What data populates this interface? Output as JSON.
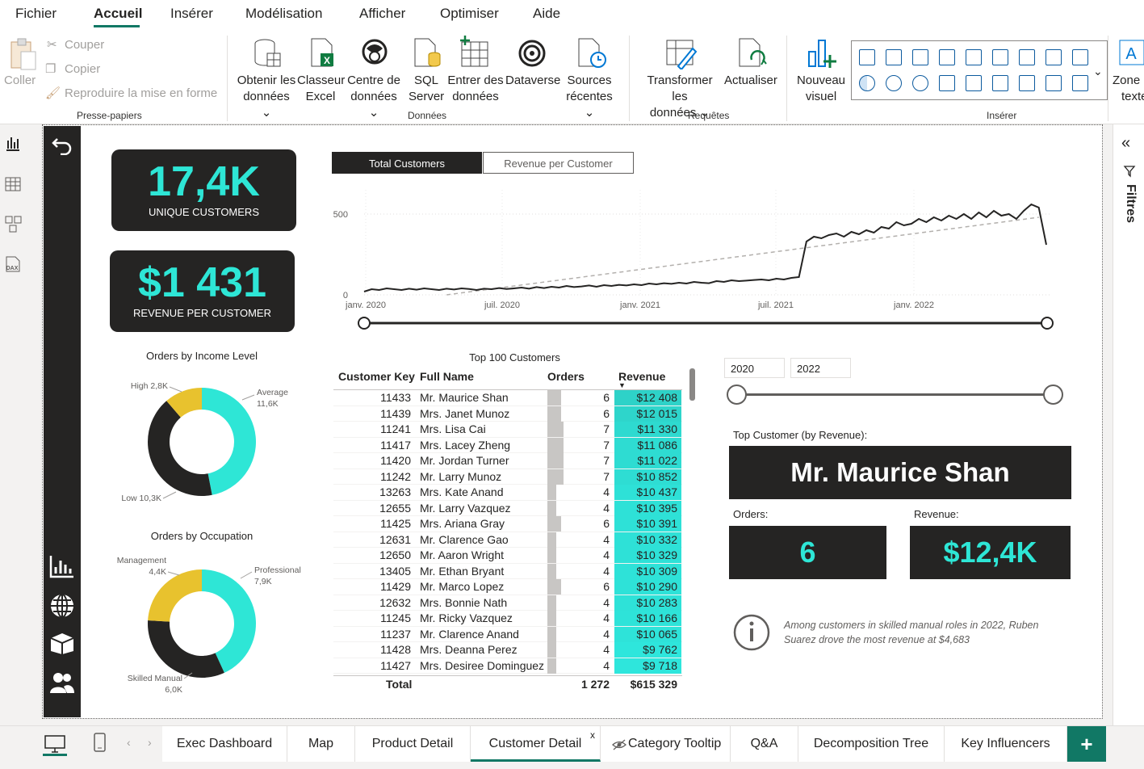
{
  "menu": {
    "items": [
      "Fichier",
      "Accueil",
      "Insérer",
      "Modélisation",
      "Afficher",
      "Optimiser",
      "Aide"
    ]
  },
  "ribbon": {
    "clipboard": {
      "paste": "Coller",
      "cut": "Couper",
      "copy": "Copier",
      "format_painter": "Reproduire la mise en forme",
      "group": "Presse-papiers"
    },
    "data": {
      "get_data": [
        "Obtenir les",
        "données"
      ],
      "excel": [
        "Classeur",
        "Excel"
      ],
      "datahub": [
        "Centre de",
        "données"
      ],
      "sql": [
        "SQL",
        "Server"
      ],
      "enter": [
        "Entrer des",
        "données"
      ],
      "dataverse": "Dataverse",
      "recent": [
        "Sources",
        "récentes"
      ],
      "group": "Données"
    },
    "queries": {
      "transform": [
        "Transformer les",
        "données"
      ],
      "refresh": "Actualiser",
      "group": "Requêtes"
    },
    "insert": {
      "new_visual": [
        "Nouveau",
        "visuel"
      ],
      "textbox": [
        "Zone",
        "texte"
      ],
      "group": "Insérer"
    }
  },
  "kpis": {
    "unique_customers_value": "17,4K",
    "unique_customers_label": "UNIQUE CUSTOMERS",
    "revenue_per_customer_value": "$1 431",
    "revenue_per_customer_label": "REVENUE PER CUSTOMER"
  },
  "line_tabs": {
    "active": "Total Customers",
    "inactive": "Revenue per Customer"
  },
  "chart_data": [
    {
      "type": "line",
      "title": "",
      "y_ticks": [
        "500",
        "0"
      ],
      "x_ticks": [
        "janv. 2020",
        "juil. 2020",
        "janv. 2021",
        "juil. 2021",
        "janv. 2022"
      ],
      "ylim": [
        0,
        600
      ],
      "series": [
        {
          "values": [
            20,
            35,
            30,
            40,
            35,
            30,
            38,
            32,
            40,
            35,
            30,
            38,
            33,
            40,
            36,
            30,
            38,
            35,
            42,
            36,
            40,
            45,
            38,
            48,
            42,
            50,
            45,
            55,
            48,
            52,
            58,
            50,
            60,
            55,
            62,
            58,
            65,
            60,
            70,
            65,
            72,
            68,
            75,
            70,
            80,
            75,
            72,
            85,
            80,
            90,
            85,
            88,
            92,
            95,
            90,
            100,
            95,
            105,
            110,
            330,
            360,
            350,
            370,
            380,
            360,
            390,
            375,
            400,
            385,
            420,
            410,
            450,
            430,
            440,
            470,
            450,
            480,
            460,
            490,
            470,
            500,
            470,
            510,
            480,
            520,
            490,
            500,
            470,
            520,
            560,
            540,
            310
          ]
        },
        {
          "values": [
            0,
            480
          ],
          "style": "dashed-trend"
        }
      ]
    },
    {
      "type": "pie",
      "title": "Orders by Income Level",
      "labels": [
        "Average",
        "Low",
        "High"
      ],
      "values": [
        11.6,
        10.3,
        2.8
      ],
      "display": [
        "11,6K",
        "10,3K",
        "2,8K"
      ],
      "colors": [
        "#2ee6d6",
        "#252423",
        "#e8c22e"
      ]
    },
    {
      "type": "pie",
      "title": "Orders by Occupation",
      "labels": [
        "Professional",
        "Skilled Manual",
        "Management"
      ],
      "values": [
        7.9,
        6.0,
        4.4
      ],
      "display": [
        "7,9K",
        "6,0K",
        "4,4K"
      ],
      "colors": [
        "#2ee6d6",
        "#252423",
        "#e8c22e"
      ]
    },
    {
      "type": "table",
      "title": "Top 100 Customers",
      "columns": [
        "Customer Key",
        "Full Name",
        "Orders",
        "Revenue"
      ],
      "rows": [
        [
          "11433",
          "Mr. Maurice Shan",
          "6",
          "$12 408"
        ],
        [
          "11439",
          "Mrs. Janet Munoz",
          "6",
          "$12 015"
        ],
        [
          "11241",
          "Mrs. Lisa Cai",
          "7",
          "$11 330"
        ],
        [
          "11417",
          "Mrs. Lacey Zheng",
          "7",
          "$11 086"
        ],
        [
          "11420",
          "Mr. Jordan Turner",
          "7",
          "$11 022"
        ],
        [
          "11242",
          "Mr. Larry Munoz",
          "7",
          "$10 852"
        ],
        [
          "13263",
          "Mrs. Kate Anand",
          "4",
          "$10 437"
        ],
        [
          "12655",
          "Mr. Larry Vazquez",
          "4",
          "$10 395"
        ],
        [
          "11425",
          "Mrs. Ariana Gray",
          "6",
          "$10 391"
        ],
        [
          "12631",
          "Mr. Clarence Gao",
          "4",
          "$10 332"
        ],
        [
          "12650",
          "Mr. Aaron Wright",
          "4",
          "$10 329"
        ],
        [
          "13405",
          "Mr. Ethan Bryant",
          "4",
          "$10 309"
        ],
        [
          "11429",
          "Mr. Marco Lopez",
          "6",
          "$10 290"
        ],
        [
          "12632",
          "Mrs. Bonnie Nath",
          "4",
          "$10 283"
        ],
        [
          "11245",
          "Mr. Ricky Vazquez",
          "4",
          "$10 166"
        ],
        [
          "11237",
          "Mr. Clarence Anand",
          "4",
          "$10 065"
        ],
        [
          "11428",
          "Mrs. Deanna Perez",
          "4",
          "$9 762"
        ],
        [
          "11427",
          "Mrs. Desiree Dominguez",
          "4",
          "$9 718"
        ]
      ],
      "total": {
        "label": "Total",
        "orders": "1 272",
        "revenue": "$615 329"
      }
    }
  ],
  "slicer": {
    "from": "2020",
    "to": "2022"
  },
  "top_customer": {
    "label": "Top Customer (by Revenue):",
    "name": "Mr. Maurice Shan",
    "orders_label": "Orders:",
    "orders_value": "6",
    "revenue_label": "Revenue:",
    "revenue_value": "$12,4K"
  },
  "insight": "Among customers in skilled manual roles in 2022, Ruben Suarez drove the most revenue at $4,683",
  "right_pane": {
    "filters_label": "Filtres"
  },
  "page_tabs": [
    "Exec Dashboard",
    "Map",
    "Product Detail",
    "Customer Detail",
    "Category Tooltip",
    "Q&A",
    "Decomposition Tree",
    "Key Influencers"
  ],
  "active_page": "Customer Detail",
  "colors": {
    "teal": "#2ee6d6",
    "dark": "#252423",
    "gold": "#e8c22e",
    "accent": "#117865"
  }
}
